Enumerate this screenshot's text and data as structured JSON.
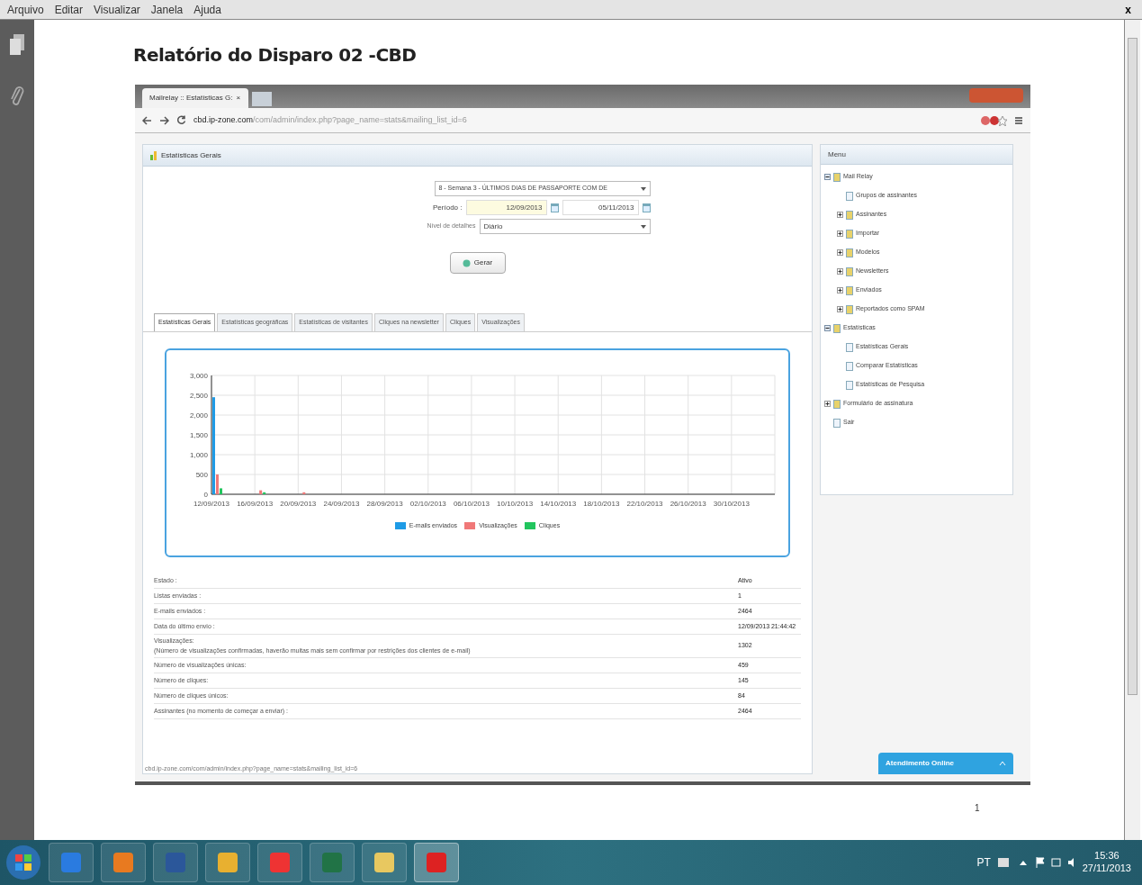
{
  "menu_bar": {
    "items": [
      "Arquivo",
      "Editar",
      "Visualizar",
      "Janela",
      "Ajuda"
    ],
    "close": "x"
  },
  "document": {
    "title": "Relatório do Disparo 02 -CBD",
    "page_number": "1"
  },
  "browser": {
    "tab": {
      "title": "Mailrelay :: Estatísticas G:",
      "close": "×"
    },
    "address": {
      "host": "cbd.ip-zone.com",
      "path": "/com/admin/index.php?page_name=stats&mailing_list_id=6"
    },
    "status_url": "cbd.ip-zone.com/com/admin/index.php?page_name=stats&mailing_list_id=6"
  },
  "panel": {
    "title": "Estatísticas Gerais",
    "form": {
      "newsletter": "8 - Semana 3 - ÚLTIMOS DIAS DE PASSAPORTE COM DE",
      "period_label": "Período :",
      "date_from": "12/09/2013",
      "date_to": "05/11/2013",
      "detail_label": "Nível de detalhes",
      "detail_value": "Diário",
      "button": "Gerar"
    },
    "tabs": [
      {
        "label": "Estatísticas Gerais",
        "selected": true
      },
      {
        "label": "Estatísticas geográficas",
        "selected": false
      },
      {
        "label": "Estatísticas de visitantes",
        "selected": false
      },
      {
        "label": "Cliques na newsletter",
        "selected": false
      },
      {
        "label": "Cliques",
        "selected": false
      },
      {
        "label": "Visualizações",
        "selected": false
      }
    ],
    "chart_data": {
      "type": "bar",
      "categories": [
        "12/09/2013",
        "16/09/2013",
        "20/09/2013",
        "24/09/2013",
        "28/09/2013",
        "02/10/2013",
        "06/10/2013",
        "10/10/2013",
        "14/10/2013",
        "18/10/2013",
        "22/10/2013",
        "26/10/2013",
        "30/10/2013"
      ],
      "series": [
        {
          "name": "E-mails enviados",
          "color": "#1e9be6",
          "values": [
            2450,
            0,
            0,
            0,
            0,
            0,
            0,
            0,
            0,
            0,
            0,
            0,
            0
          ]
        },
        {
          "name": "Visualizações",
          "color": "#f07878",
          "values": [
            500,
            100,
            50,
            0,
            0,
            0,
            0,
            0,
            0,
            0,
            0,
            0,
            0
          ]
        },
        {
          "name": "Cliques",
          "color": "#22c55e",
          "values": [
            150,
            50,
            0,
            0,
            0,
            0,
            0,
            0,
            0,
            0,
            0,
            0,
            0
          ]
        }
      ],
      "grid": true,
      "yticks": [
        {
          "value": 0,
          "label": "0"
        },
        {
          "value": 500,
          "label": "500"
        },
        {
          "value": 1000,
          "label": "1,000"
        },
        {
          "value": 1500,
          "label": "1,500"
        },
        {
          "value": 2000,
          "label": "2,000"
        },
        {
          "value": 2500,
          "label": "2,500"
        },
        {
          "value": 3000,
          "label": "3,000"
        }
      ],
      "ylim": [
        0,
        3000
      ]
    },
    "stats": [
      {
        "label": "Estado :",
        "value": "Ativo"
      },
      {
        "label": "Listas enviadas :",
        "value": "1"
      },
      {
        "label": "E-mails enviados :",
        "value": "2464"
      },
      {
        "label": "Data do último envio :",
        "value": "12/09/2013 21:44:42"
      },
      {
        "label": "Visualizações:",
        "note": "(Número de visualizações confirmadas, haverão muitas mais sem confirmar por restrições dos clientes de e-mail)",
        "value": "1302"
      },
      {
        "label": "Número de visualizações únicas:",
        "value": "459"
      },
      {
        "label": "Número de cliques:",
        "value": "145"
      },
      {
        "label": "Número de cliques únicos:",
        "value": "84"
      },
      {
        "label": "Assinantes (no momento de começar a enviar) :",
        "value": "2464"
      }
    ]
  },
  "menu": {
    "title": "Menu",
    "items": [
      {
        "label": "Mail Relay",
        "kind": "node",
        "expanded": true,
        "children": [
          {
            "label": "Grupos de assinantes",
            "kind": "leaf"
          },
          {
            "label": "Assinantes",
            "kind": "node",
            "expanded": false
          },
          {
            "label": "Importar",
            "kind": "node",
            "expanded": false
          },
          {
            "label": "Modelos",
            "kind": "node",
            "expanded": false
          },
          {
            "label": "Newsletters",
            "kind": "node",
            "expanded": false
          },
          {
            "label": "Enviados",
            "kind": "node",
            "expanded": false
          },
          {
            "label": "Reportados como SPAM",
            "kind": "node",
            "expanded": false
          }
        ]
      },
      {
        "label": "Estatísticas",
        "kind": "node",
        "expanded": true,
        "children": [
          {
            "label": "Estatísticas Gerais",
            "kind": "leaf"
          },
          {
            "label": "Comparar Estatísticas",
            "kind": "leaf"
          },
          {
            "label": "Estatísticas de Pesquisa",
            "kind": "leaf"
          }
        ]
      },
      {
        "label": "Formulário de assinatura",
        "kind": "node",
        "expanded": false
      },
      {
        "label": "Sair",
        "kind": "leaf"
      }
    ]
  },
  "chat_button": "Atendimento Online",
  "taskbar": {
    "language": "PT",
    "time": "15:36",
    "date": "27/11/2013"
  }
}
